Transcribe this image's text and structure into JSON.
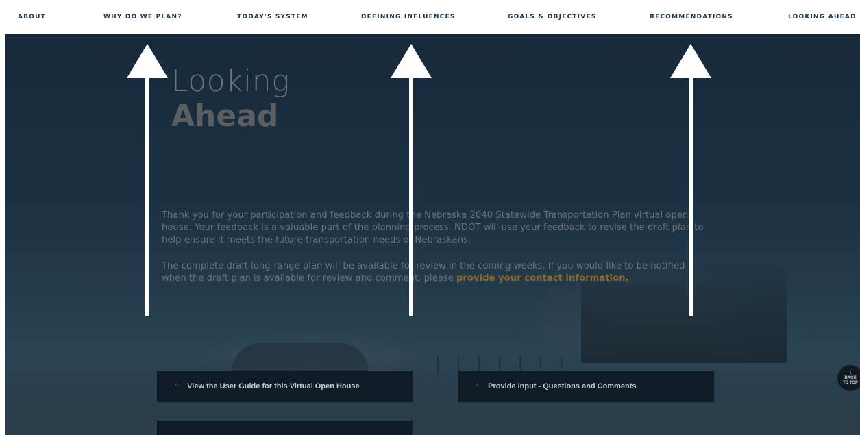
{
  "nav": {
    "items": [
      {
        "label": "ABOUT"
      },
      {
        "label": "WHY DO WE PLAN?"
      },
      {
        "label": "TODAY'S SYSTEM"
      },
      {
        "label": "DEFINING INFLUENCES"
      },
      {
        "label": "GOALS & OBJECTIVES"
      },
      {
        "label": "RECOMMENDATIONS"
      },
      {
        "label": "LOOKING AHEAD"
      }
    ]
  },
  "hero": {
    "title_light": "Looking",
    "title_bold": "Ahead",
    "paragraph1": "Thank you for your participation and feedback during the Nebraska 2040 Statewide Transportation Plan virtual open house. Your feedback is a valuable part of the planning process. NDOT will use your feedback to revise the draft plan to help ensure it meets the future transportation needs of Nebraskans.",
    "paragraph2_prefix": "The complete draft long-range plan will be available for review in the coming weeks. If you would like to be notified when the draft plan is available for review and comment, please ",
    "paragraph2_link": "provide your contact information."
  },
  "accordions": [
    {
      "label": "View the User Guide for this Virtual Open House"
    },
    {
      "label": "Provide Input - Questions and Comments"
    },
    {
      "label": ""
    }
  ],
  "back_to_top": {
    "line1": "BACK",
    "line2": "TO TOP"
  },
  "colors": {
    "nav_text": "#1c3550",
    "hero_bg": "#1b3143",
    "link_gold": "#8a6a2a",
    "arrow": "#ffffff"
  },
  "icons": {
    "chevron": "chevron-up-icon",
    "back_to_top": "arrow-up-icon"
  }
}
